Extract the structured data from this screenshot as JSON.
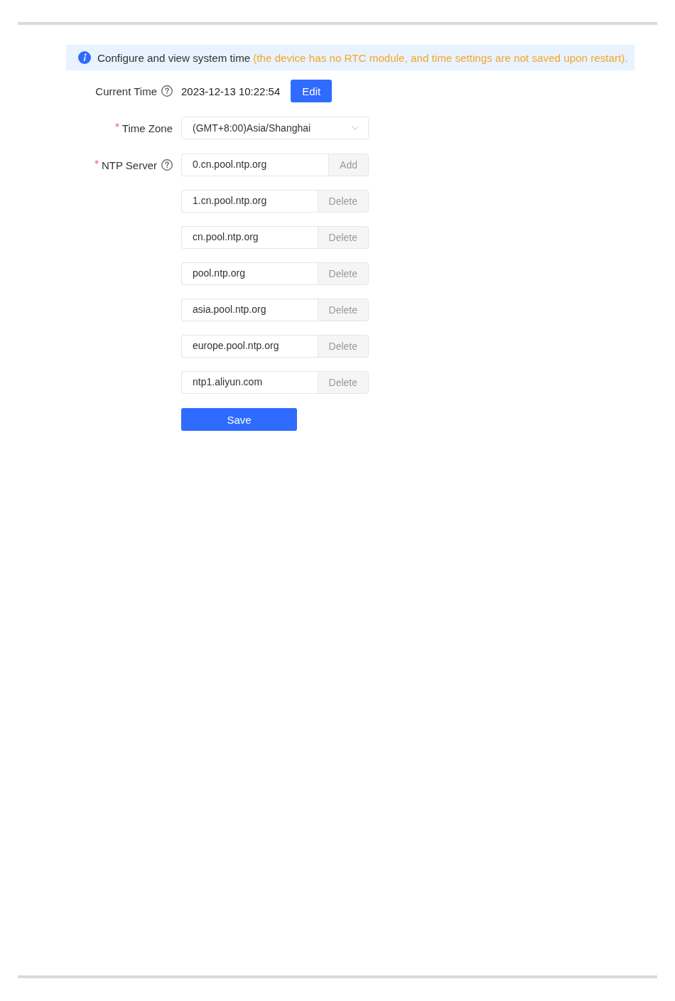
{
  "banner": {
    "text": "Configure and view system time",
    "note": "(the device has no RTC module, and time settings are not saved upon restart)."
  },
  "fields": [
    {
      "kind": "display",
      "label": "Current Time",
      "required": false,
      "help": true,
      "value": "2023-12-13 10:22:54",
      "button": "Edit"
    },
    {
      "kind": "select",
      "label": "Time Zone",
      "required": true,
      "help": false,
      "value": "(GMT+8:00)Asia/Shanghai"
    },
    {
      "kind": "list",
      "label": "NTP Server",
      "required": true,
      "help": true,
      "servers": [
        {
          "value": "0.cn.pool.ntp.org",
          "button": "Add"
        },
        {
          "value": "1.cn.pool.ntp.org",
          "button": "Delete"
        },
        {
          "value": "cn.pool.ntp.org",
          "button": "Delete"
        },
        {
          "value": "pool.ntp.org",
          "button": "Delete"
        },
        {
          "value": "asia.pool.ntp.org",
          "button": "Delete"
        },
        {
          "value": "europe.pool.ntp.org",
          "button": "Delete"
        },
        {
          "value": "ntp1.aliyun.com",
          "button": "Delete"
        }
      ]
    }
  ],
  "save_button": "Save"
}
